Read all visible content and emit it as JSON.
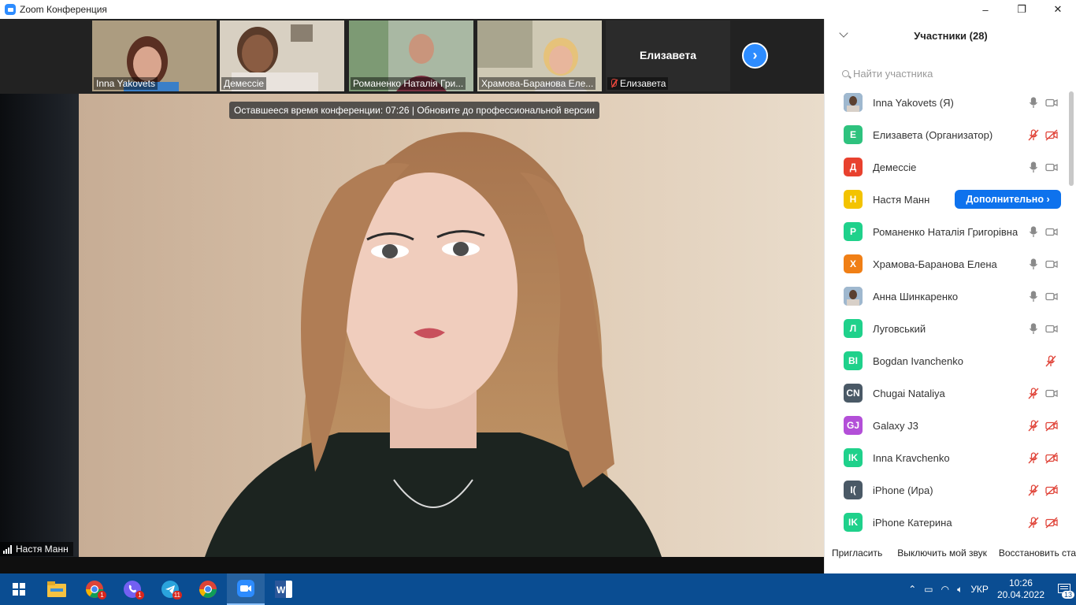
{
  "window": {
    "title": "Zoom Конференция",
    "controls": {
      "minimize": "–",
      "maximize": "❐",
      "close": "✕"
    }
  },
  "gallery": {
    "thumbnails": [
      {
        "name": "Inna Yakovets"
      },
      {
        "name": "Демессіе"
      },
      {
        "name": "Романенко Наталія Гри..."
      },
      {
        "name": "Храмова-Баранова Еле..."
      },
      {
        "name": "Елизавета",
        "center_name": "Елизавета",
        "muted": true
      }
    ],
    "next_label": "›"
  },
  "meeting": {
    "timer_banner": "Оставшееся время конференции: 07:26 | Обновите до профессиональной версии",
    "active_speaker": "Настя Манн"
  },
  "participants_panel": {
    "title": "Участники (28)",
    "search_placeholder": "Найти участника",
    "more_button": "Дополнительно ›",
    "participants": [
      {
        "name": "Inna Yakovets (Я)",
        "avatar": "",
        "color": "#6b8fb5",
        "mic": "on",
        "cam": "on"
      },
      {
        "name": "Елизавета (Организатор)",
        "avatar": "Е",
        "color": "#2ec27e",
        "mic": "muted",
        "cam": "off"
      },
      {
        "name": "Демессіе",
        "avatar": "Д",
        "color": "#e8412e",
        "mic": "on",
        "cam": "on"
      },
      {
        "name": "Настя Манн",
        "avatar": "Н",
        "color": "#f3c300",
        "mic": "hover",
        "cam": "hover"
      },
      {
        "name": "Романенко Наталія Григорівна",
        "avatar": "Р",
        "color": "#1fd18b",
        "mic": "on",
        "cam": "on"
      },
      {
        "name": "Храмова-Баранова Елена",
        "avatar": "Х",
        "color": "#f07f16",
        "mic": "on",
        "cam": "on"
      },
      {
        "name": "Анна Шинкаренко",
        "avatar": "",
        "color": "#7c8fa3",
        "mic": "on",
        "cam": "on"
      },
      {
        "name": "Луговський",
        "avatar": "Л",
        "color": "#1fd18b",
        "mic": "on",
        "cam": "on"
      },
      {
        "name": "Bogdan Ivanchenko",
        "avatar": "BI",
        "color": "#1fd18b",
        "mic": "none",
        "cam": "muted-only"
      },
      {
        "name": "Chugai Nataliya",
        "avatar": "CN",
        "color": "#4a5966",
        "mic": "muted",
        "cam": "on"
      },
      {
        "name": "Galaxy J3",
        "avatar": "GJ",
        "color": "#b34fd8",
        "mic": "muted",
        "cam": "off"
      },
      {
        "name": "Inna Kravchenko",
        "avatar": "IK",
        "color": "#1fd18b",
        "mic": "muted",
        "cam": "off"
      },
      {
        "name": "iPhone (Ира)",
        "avatar": "I(",
        "color": "#4a5966",
        "mic": "muted",
        "cam": "off"
      },
      {
        "name": "iPhone Катерина",
        "avatar": "IK",
        "color": "#1fd18b",
        "mic": "muted",
        "cam": "off"
      }
    ],
    "footer": {
      "invite": "Пригласить",
      "mute_me": "Выключить мой звук",
      "restore": "Восстановить стат"
    }
  },
  "taskbar": {
    "language": "УКР",
    "time": "10:26",
    "date": "20.04.2022",
    "notification_count": "13",
    "badges": {
      "chrome": "1",
      "viber": "1",
      "telegram": "11"
    }
  },
  "colors": {
    "zoom_blue": "#2d8cff",
    "more_button": "#0e72ed",
    "muted_red": "#e0453a",
    "taskbar": "#0a4d92"
  }
}
